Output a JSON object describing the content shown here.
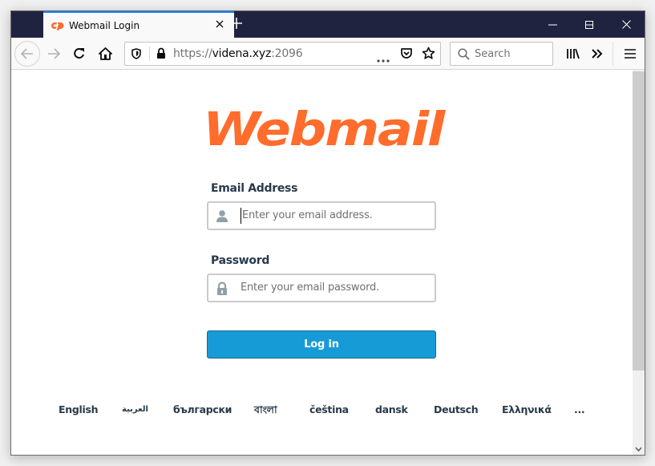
{
  "browser": {
    "tab": {
      "title": "Webmail Login",
      "favicon": "cpanel-icon"
    },
    "new_tab_label": "+",
    "window_controls": [
      "minimize",
      "maximize",
      "close"
    ],
    "url": {
      "scheme": "https://",
      "host": "videna.xyz",
      "port": ":2096"
    },
    "search": {
      "placeholder": "Search"
    },
    "icons": {
      "back": "arrow-left-icon",
      "forward": "arrow-right-icon",
      "reload": "reload-icon",
      "home": "home-icon",
      "tracking": "shield-icon",
      "lock": "lock-icon",
      "page_actions": "more-dots-icon",
      "pocket": "pocket-icon",
      "bookmark": "star-icon",
      "library": "library-icon",
      "overflow": "double-chevron-icon",
      "menu": "hamburger-icon"
    }
  },
  "page": {
    "logo_text": "Webmail",
    "brand_color": "#ff6c2c",
    "email": {
      "label": "Email Address",
      "placeholder": "Enter your email address.",
      "value": ""
    },
    "password": {
      "label": "Password",
      "placeholder": "Enter your email password.",
      "value": ""
    },
    "login_button": "Log in",
    "button_color": "#179bd7",
    "languages": [
      "English",
      "العربية",
      "български",
      "বাংলা",
      "čeština",
      "dansk",
      "Deutsch",
      "Ελληνικά",
      "..."
    ]
  }
}
